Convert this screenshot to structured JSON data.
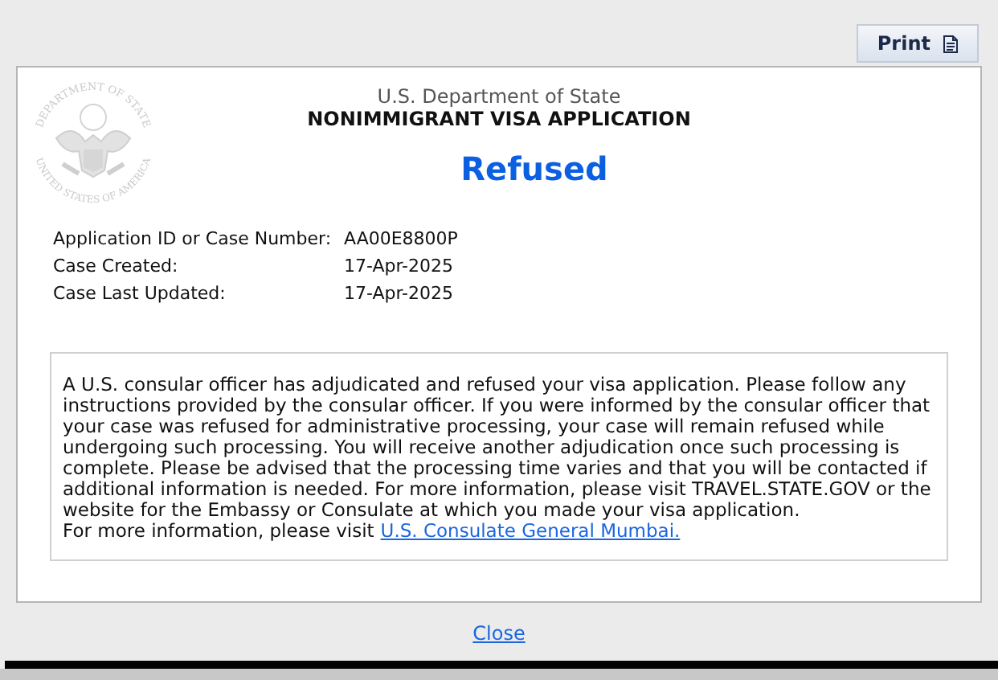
{
  "print_button": {
    "label": "Print"
  },
  "seal": {
    "top_text": "DEPARTMENT OF STATE",
    "bottom_text": "UNITED STATES OF AMERICA"
  },
  "header": {
    "agency": "U.S. Department of State",
    "form_title": "NONIMMIGRANT VISA APPLICATION",
    "status": "Refused"
  },
  "details": [
    {
      "label": "Application ID or Case Number:",
      "value": "AA00E8800P"
    },
    {
      "label": "Case Created:",
      "value": "17-Apr-2025"
    },
    {
      "label": "Case Last Updated:",
      "value": "17-Apr-2025"
    }
  ],
  "message": {
    "text": "A U.S. consular officer has adjudicated and refused your visa application. Please follow any instructions provided by the consular officer. If you were informed by the consular officer that your case was refused for administrative processing, your case will remain refused while undergoing such processing. You will receive another adjudication once such processing is complete. Please be advised that the processing time varies and that you will be contacted if additional information is needed. For more information, please visit TRAVEL.STATE.GOV or the website for the Embassy or Consulate at which you made your visa application.",
    "more_info": "For more information, please visit",
    "link": "U.S. Consulate General Mumbai."
  },
  "close_link": "Close"
}
